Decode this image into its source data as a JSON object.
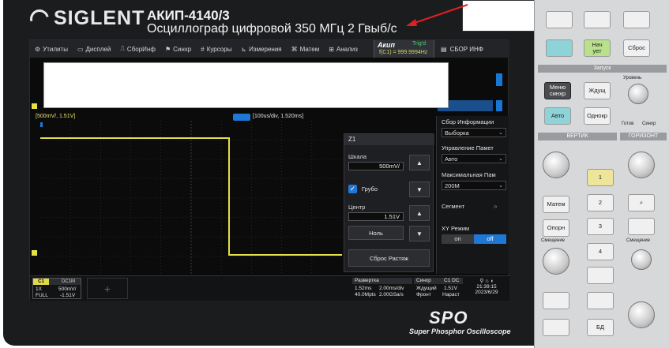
{
  "header": {
    "brand": "SIGLENT",
    "model": "АКИП-4140/3",
    "description": "Осциллограф цифровой   350 МГц   2 Гвыб/с"
  },
  "menubar": {
    "items": [
      {
        "icon": "gear-icon",
        "glyph": "⚙",
        "label": "Утилиты"
      },
      {
        "icon": "display-icon",
        "glyph": "▭",
        "label": "Дисплей"
      },
      {
        "icon": "acquire-icon",
        "glyph": "⎍",
        "label": "СборИнф"
      },
      {
        "icon": "flag-icon",
        "glyph": "⚑",
        "label": "Синхр"
      },
      {
        "icon": "cursor-icon",
        "glyph": "#",
        "label": "Курсоры"
      },
      {
        "icon": "measure-icon",
        "glyph": "⊾",
        "label": "Измерения"
      },
      {
        "icon": "math-icon",
        "glyph": "⌘",
        "label": "Матем"
      },
      {
        "icon": "analysis-icon",
        "glyph": "⊞",
        "label": "Анализ"
      }
    ],
    "acq_mode": "Акип",
    "trig_status": "Trig'd",
    "trig_freq": "f(C1) = 999.9994Hz",
    "info_menu": "СБОР ИНФ"
  },
  "scope": {
    "channel_scale": "[500mV/, 1.51V]",
    "time_scale": "[100us/div, 1.520ms]"
  },
  "side_panel": {
    "title": "Сбор Информации",
    "acq_select": "Выборка",
    "mem_label": "Управление Памет",
    "mem_select": "Авто",
    "maxmem_label": "Максимальная Пам",
    "maxmem_select": "200M",
    "segment_label": "Сегмент",
    "xy_label": "XY Режим",
    "xy_off": "on",
    "xy_on": "off"
  },
  "zoom_dialog": {
    "title": "Z1",
    "scale_label": "Шкала",
    "scale_value": "500mV/",
    "coarse_label": "Грубо",
    "center_label": "Центр",
    "center_value": "1.51V",
    "null_label": "Ноль",
    "reset_label": "Сброс Растяж"
  },
  "bottom": {
    "c1": {
      "tag": "C1",
      "coupling": "DC1M",
      "ratio": "1X",
      "volts": "500mV/",
      "bw": "FULL",
      "offset": "-1.51V"
    },
    "sweep": {
      "title": "Развертка",
      "t1": "1.52ms",
      "t2": "2.00ms/div",
      "t3": "40.0Mpts",
      "t4": "2.00GSa/s"
    },
    "trigger": {
      "title": "Синхр",
      "ch": "C1 DC",
      "mode": "Ждущий",
      "level": "1.51V",
      "edge": "Фронт",
      "slope": "Нараст"
    },
    "clock": {
      "time": "21:39:15",
      "date": "2023/6/29"
    }
  },
  "bezel": {
    "logo": "SPO",
    "subtitle": "Super Phosphor Oscilloscope"
  },
  "panel": {
    "run_title": "Запуск",
    "vert_title": "ВЕРТИК",
    "horiz_title": "ГОРИЗОНТ",
    "btn_start": "Нач\nует",
    "btn_reset": "Сброс",
    "btn_menu_sync": "Меню синхр",
    "btn_wait": "Ждущ",
    "btn_auto": "Авто",
    "btn_single": "Однокр",
    "btn_level": "Уровень",
    "ready_label": "Готов",
    "sync_label": "Синхр",
    "btn_math": "Матем",
    "btn_ref": "Опорн",
    "btn_shift": "Смещение",
    "btn_bd": "БД",
    "ch1": "1",
    "ch2": "2",
    "ch3": "3",
    "ch4": "4"
  },
  "colors": {
    "trace": "#e4e04a",
    "accent": "#1f77d6",
    "trig_ok": "#4bd36b",
    "arrow": "#e02020"
  }
}
